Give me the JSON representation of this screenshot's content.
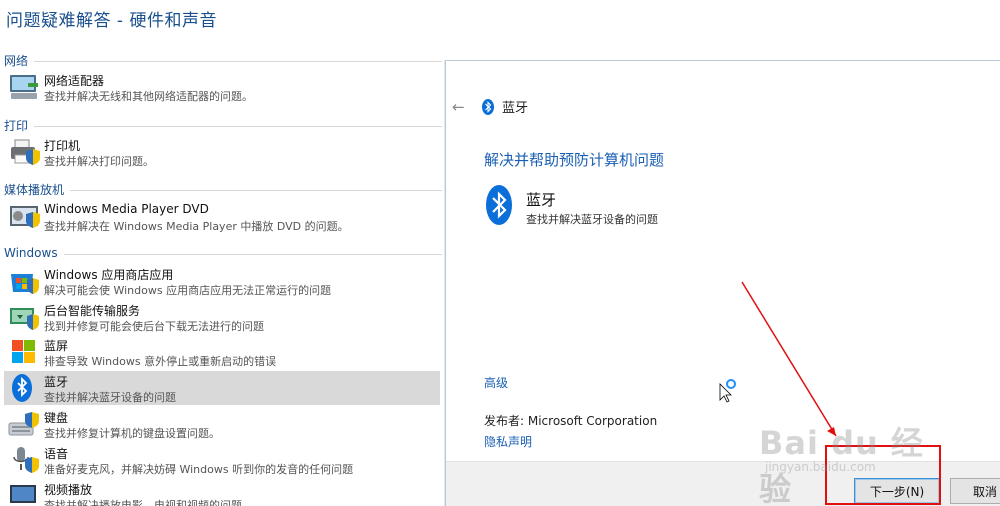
{
  "window": {
    "title": "问题疑难解答 - 硬件和声音"
  },
  "categories": [
    {
      "id": "network",
      "label": "网络"
    },
    {
      "id": "print",
      "label": "打印"
    },
    {
      "id": "media",
      "label": "媒体播放机"
    },
    {
      "id": "windows",
      "label": "Windows"
    }
  ],
  "items": [
    {
      "name": "网络适配器",
      "desc": "查找并解决无线和其他网络适配器的问题。",
      "icon": "network-adapter-icon"
    },
    {
      "name": "打印机",
      "desc": "查找并解决打印问题。",
      "icon": "printer-icon"
    },
    {
      "name": "Windows Media Player DVD",
      "desc": "查找并解决在 Windows Media Player 中播放 DVD 的问题。",
      "icon": "media-player-dvd-icon"
    },
    {
      "name": "Windows 应用商店应用",
      "desc": "解决可能会使 Windows 应用商店应用无法正常运行的问题",
      "icon": "store-apps-icon"
    },
    {
      "name": "后台智能传输服务",
      "desc": "找到并修复可能会使后台下载无法进行的问题",
      "icon": "bits-icon"
    },
    {
      "name": "蓝屏",
      "desc": "排查导致 Windows 意外停止或重新启动的错误",
      "icon": "blue-screen-icon"
    },
    {
      "name": "蓝牙",
      "desc": "查找并解决蓝牙设备的问题",
      "icon": "bluetooth-icon",
      "selected": true
    },
    {
      "name": "键盘",
      "desc": "查找并修复计算机的键盘设置问题。",
      "icon": "keyboard-icon"
    },
    {
      "name": "语音",
      "desc": "准备好麦克风，并解决妨碍 Windows 听到你的发音的任何问题",
      "icon": "microphone-icon"
    },
    {
      "name": "视频播放",
      "desc": "查找并解决播放电影、电视和视频的问题",
      "icon": "video-playback-icon"
    }
  ],
  "dialog": {
    "back_icon": "back-arrow-icon",
    "title": "蓝牙",
    "heading": "解决并帮助预防计算机问题",
    "item_name": "蓝牙",
    "item_desc": "查找并解决蓝牙设备的问题",
    "advanced": "高级",
    "publisher": "发布者:  Microsoft Corporation",
    "privacy": "隐私声明",
    "next_button": "下一步(N)",
    "cancel_button": "取消"
  },
  "watermark": {
    "text": "Bai du 经验",
    "url": "jingyan.baidu.com"
  },
  "colors": {
    "link": "#1a5fb4",
    "bluetooth": "#0a6fd8",
    "annotation": "#e01010"
  }
}
